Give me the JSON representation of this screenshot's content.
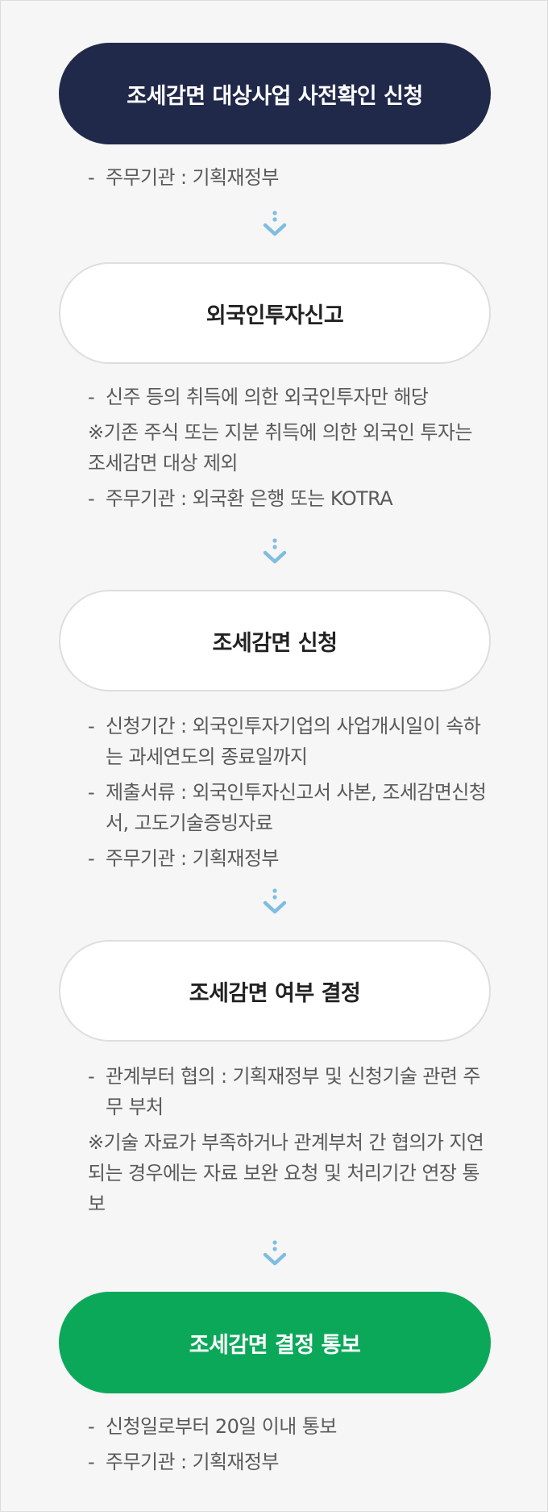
{
  "steps": [
    {
      "title": "조세감면 대상사업 사전확인 신청",
      "notes": [
        {
          "type": "dash",
          "text": "주무기관 : 기획재정부"
        }
      ]
    },
    {
      "title": "외국인투자신고",
      "notes": [
        {
          "type": "dash",
          "text": "신주 등의 취득에 의한 외국인투자만 해당"
        },
        {
          "type": "remark",
          "text": "※기존 주식 또는 지분 취득에 의한 외국인 투자는 조세감면 대상 제외"
        },
        {
          "type": "dash",
          "text": "주무기관 : 외국환 은행 또는 KOTRA"
        }
      ]
    },
    {
      "title": "조세감면 신청",
      "notes": [
        {
          "type": "dash",
          "text": "신청기간 : 외국인투자기업의 사업개시일이 속하는 과세연도의 종료일까지"
        },
        {
          "type": "dash",
          "text": "제출서류 : 외국인투자신고서 사본, 조세감면신청서, 고도기술증빙자료"
        },
        {
          "type": "dash",
          "text": "주무기관 : 기획재정부"
        }
      ]
    },
    {
      "title": "조세감면 여부 결정",
      "notes": [
        {
          "type": "dash",
          "text": "관계부터 협의 : 기획재정부 및 신청기술 관련 주무 부처"
        },
        {
          "type": "remark",
          "text": "※기술 자료가 부족하거나 관계부처 간 협의가 지연되는 경우에는 자료 보완 요청 및 처리기간 연장 통보"
        }
      ]
    },
    {
      "title": "조세감면 결정 통보",
      "notes": [
        {
          "type": "dash",
          "text": "신청일로부터 20일 이내 통보"
        },
        {
          "type": "dash",
          "text": "주무기관 : 기획재정부"
        }
      ]
    }
  ],
  "colors": {
    "navy": "#21294a",
    "green": "#0ba85a",
    "arrow": "#7fbde0"
  },
  "icons": {
    "connector": "dotted-chevron-down-icon"
  }
}
